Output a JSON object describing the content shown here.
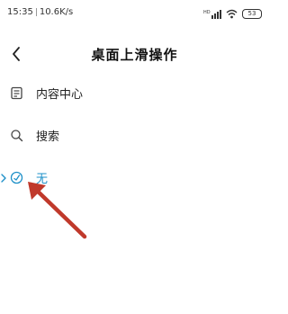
{
  "status_bar": {
    "time": "15:35",
    "speed": "10.6K/s",
    "signal_text": "HD",
    "battery": "53"
  },
  "header": {
    "title": "桌面上滑操作"
  },
  "options": [
    {
      "label": "内容中心",
      "icon": "content-center-icon",
      "selected": false
    },
    {
      "label": "搜索",
      "icon": "search-icon",
      "selected": false
    },
    {
      "label": "无",
      "icon": "check-circle-icon",
      "selected": true
    }
  ],
  "colors": {
    "accent": "#1e90c8",
    "annotation_arrow": "#c0392b"
  }
}
